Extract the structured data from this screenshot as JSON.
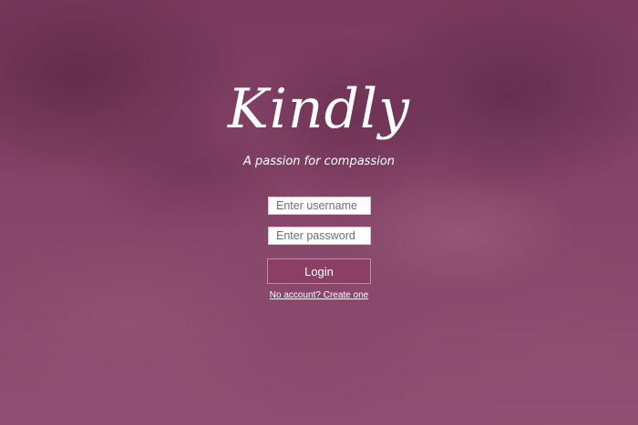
{
  "brand": {
    "name": "Kindly",
    "tagline": "A passion for compassion"
  },
  "login_form": {
    "username_placeholder": "Enter username",
    "password_placeholder": "Enter password",
    "login_label": "Login",
    "create_account_link": "No account? Create one"
  },
  "colors": {
    "overlay": "#7a3f60",
    "button_bg": "#8a3f63",
    "button_border": "#c48aa5",
    "text": "#ffffff"
  }
}
